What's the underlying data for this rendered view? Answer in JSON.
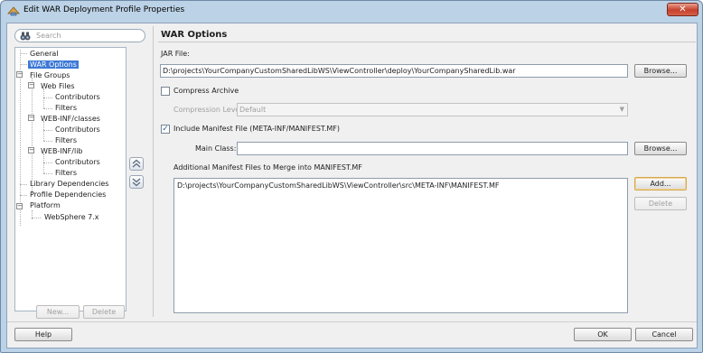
{
  "window": {
    "title": "Edit WAR Deployment Profile Properties",
    "close_glyph": "✕"
  },
  "search": {
    "placeholder": "Search"
  },
  "tree": {
    "items": [
      {
        "label": "General"
      },
      {
        "label": "WAR Options",
        "selected": true
      },
      {
        "label": "File Groups"
      },
      {
        "label": "Web Files"
      },
      {
        "label": "Contributors"
      },
      {
        "label": "Filters"
      },
      {
        "label": "WEB-INF/classes"
      },
      {
        "label": "Contributors"
      },
      {
        "label": "Filters"
      },
      {
        "label": "WEB-INF/lib"
      },
      {
        "label": "Contributors"
      },
      {
        "label": "Filters"
      },
      {
        "label": "Library Dependencies"
      },
      {
        "label": "Profile Dependencies"
      },
      {
        "label": "Platform"
      },
      {
        "label": "WebSphere 7.x"
      }
    ],
    "new_label": "New...",
    "delete_label": "Delete"
  },
  "section": {
    "title": "WAR Options"
  },
  "jar_file": {
    "label": "JAR File:",
    "value": "D:\\projects\\YourCompanyCustomSharedLibWS\\ViewController\\deploy\\YourCompanySharedLib.war",
    "browse_label": "Browse..."
  },
  "compress": {
    "label": "Compress Archive",
    "checked": false,
    "level_label": "Compression Level",
    "level_value": "Default"
  },
  "manifest": {
    "include_label": "Include Manifest File (META-INF/MANIFEST.MF)",
    "checked": true,
    "main_class_label": "Main Class:",
    "main_class_value": "",
    "browse_label": "Browse...",
    "additional_label": "Additional Manifest Files to Merge into MANIFEST.MF",
    "files": [
      "D:\\projects\\YourCompanyCustomSharedLibWS\\ViewController\\src\\META-INF\\MANIFEST.MF"
    ],
    "add_label": "Add...",
    "delete_label": "Delete"
  },
  "footer": {
    "help_label": "Help",
    "ok_label": "OK",
    "cancel_label": "Cancel"
  },
  "icons": {
    "title": "war-profile-icon",
    "search": "binoculars-icon",
    "move_up": "chevron-up-icon",
    "move_down": "chevron-down-icon"
  },
  "colors": {
    "selection": "#3c78d6",
    "window_frame": "#bcd2e6",
    "close_button": "#c6402c"
  }
}
